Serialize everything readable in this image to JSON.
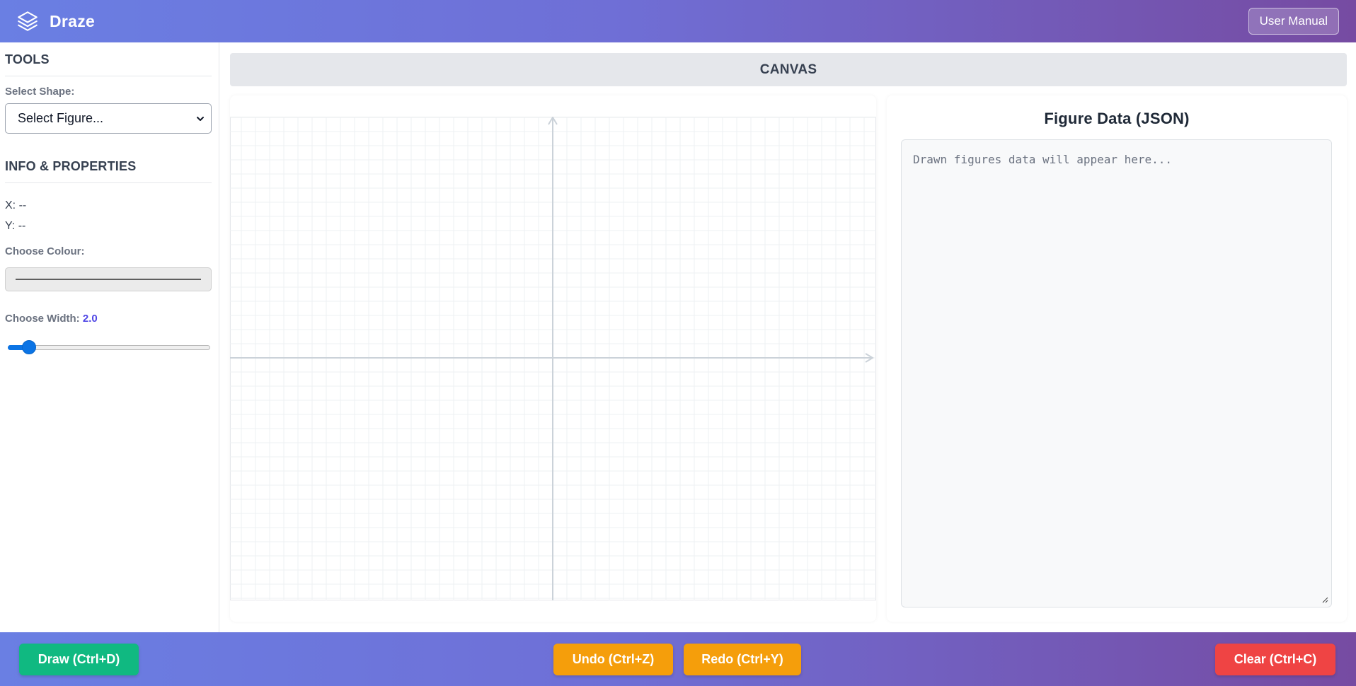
{
  "app": {
    "name": "Draze",
    "user_manual_label": "User Manual"
  },
  "sidebar": {
    "tools_title": "TOOLS",
    "select_shape_label": "Select Shape:",
    "select_shape_value": "Select Figure...",
    "info_title": "INFO & PROPERTIES",
    "x_label": "X:",
    "x_value": "--",
    "y_label": "Y:",
    "y_value": "--",
    "colour_label": "Choose Colour:",
    "colour_value": "#5f5f5f",
    "width_label": "Choose Width:",
    "width_value": "2.0",
    "width_min": 0.5,
    "width_max": 20,
    "width_level": 2.0
  },
  "main": {
    "canvas_title": "CANVAS",
    "json_title": "Figure Data (JSON)",
    "json_placeholder": "Drawn figures data will appear here..."
  },
  "footer": {
    "draw_label": "Draw (Ctrl+D)",
    "undo_label": "Undo (Ctrl+Z)",
    "redo_label": "Redo (Ctrl+Y)",
    "clear_label": "Clear (Ctrl+C)"
  },
  "colors": {
    "header_gradient_start": "#6a7fe3",
    "header_gradient_end": "#764ba2",
    "draw_button": "#10b981",
    "undo_redo_button": "#f59e0b",
    "clear_button": "#ef4444",
    "accent": "#4f46e5"
  },
  "icons": {
    "brand": "layers-icon",
    "select_caret": "chevron-down-icon",
    "resize": "resize-grip-icon"
  }
}
